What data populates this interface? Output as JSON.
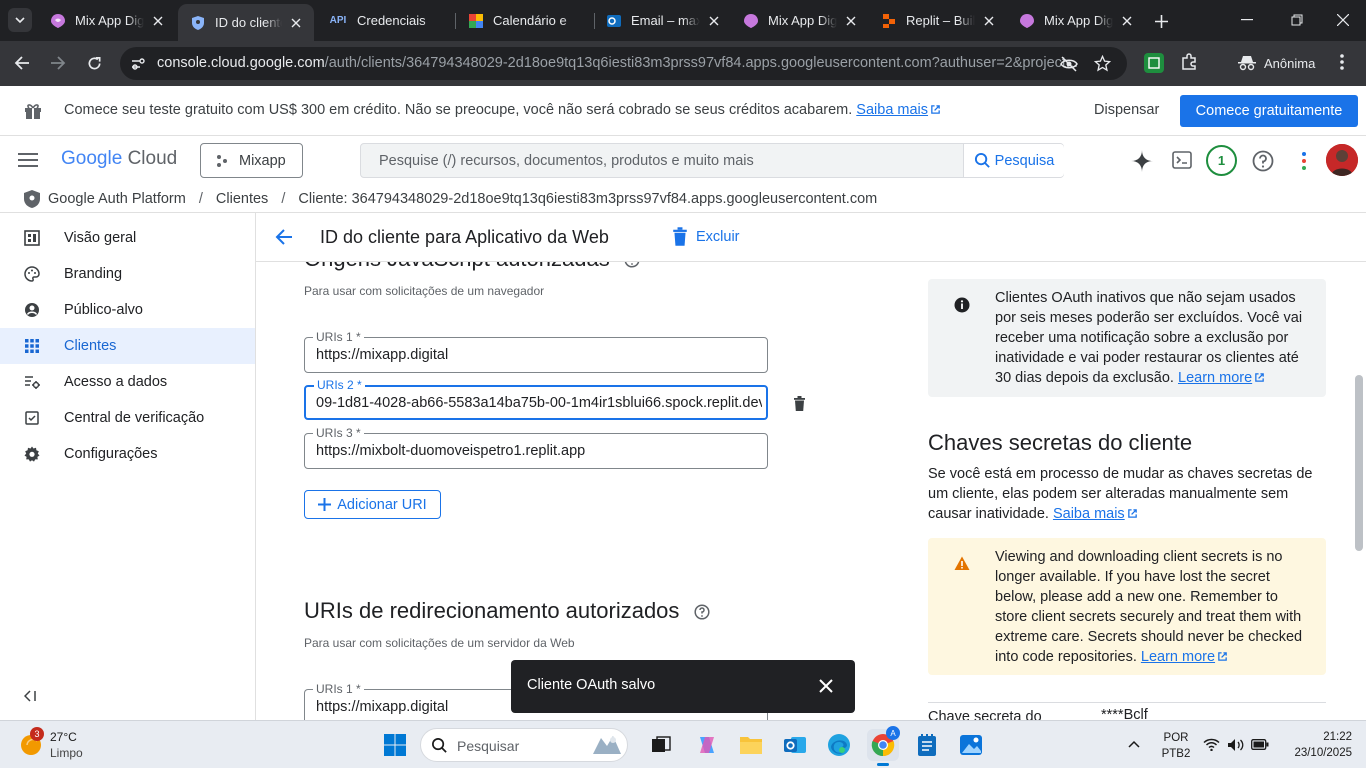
{
  "browser": {
    "tabs": [
      {
        "title": "Mix App Digital",
        "icon": "mixapp-icon"
      },
      {
        "title": "ID do cliente",
        "icon": "shield-icon",
        "active": true
      },
      {
        "title": "Credenciais",
        "icon": "api-icon"
      },
      {
        "title": "Calendário e",
        "icon": "calendar-icon"
      },
      {
        "title": "Email – max",
        "icon": "outlook-icon"
      },
      {
        "title": "Mix App Digital",
        "icon": "mixapp-icon"
      },
      {
        "title": "Replit – Build",
        "icon": "replit-icon"
      },
      {
        "title": "Mix App Digital",
        "icon": "mixapp-icon"
      }
    ],
    "url_main": "console.cloud.google.com",
    "url_rest": "/auth/clients/364794348029-2d18oe9tq13q6iesti83m3prss97vf84.apps.googleusercontent.com?authuser=2&project...",
    "profile_label": "Anônima"
  },
  "banner": {
    "text": "Comece seu teste gratuito com US$ 300 em crédito. Não se preocupe, você não será cobrado se seus créditos acabarem.",
    "link": "Saiba mais",
    "dismiss": "Dispensar",
    "cta": "Comece gratuitamente"
  },
  "header": {
    "logo_google": "Google",
    "logo_cloud": "Cloud",
    "project": "Mixapp",
    "search_placeholder": "Pesquise (/) recursos, documentos, produtos e muito mais",
    "search_button": "Pesquisa",
    "notification_count": "1"
  },
  "breadcrumb": {
    "items": [
      "Google Auth Platform",
      "Clientes",
      "Cliente: 364794348029-2d18oe9tq13q6iesti83m3prss97vf84.apps.googleusercontent.com"
    ],
    "separator": "/"
  },
  "sidebar": {
    "items": [
      {
        "label": "Visão geral",
        "icon": "dashboard-icon"
      },
      {
        "label": "Branding",
        "icon": "palette-icon"
      },
      {
        "label": "Público-alvo",
        "icon": "person-icon"
      },
      {
        "label": "Clientes",
        "icon": "grid-icon",
        "selected": true
      },
      {
        "label": "Acesso a dados",
        "icon": "data-access-icon"
      },
      {
        "label": "Central de verificação",
        "icon": "checkbox-icon"
      },
      {
        "label": "Configurações",
        "icon": "gear-icon"
      }
    ]
  },
  "page": {
    "title": "ID do cliente para Aplicativo da Web",
    "delete_label": "Excluir",
    "origins": {
      "title": "Origens JavaScript autorizadas",
      "hint": "Para usar com solicitações de um navegador",
      "uris": [
        {
          "label": "URIs 1 *",
          "value": "https://mixapp.digital"
        },
        {
          "label": "URIs 2 *",
          "value": "09-1d81-4028-ab66-5583a14ba75b-00-1m4ir1sblui66.spock.replit.dev"
        },
        {
          "label": "URIs 3 *",
          "value": "https://mixbolt-duomoveispetro1.replit.app"
        }
      ],
      "add_label": "Adicionar URI"
    },
    "redirects": {
      "title": "URIs de redirecionamento autorizados",
      "hint": "Para usar com solicitações de um servidor da Web",
      "uris": [
        {
          "label": "URIs 1 *",
          "value": "https://mixapp.digital"
        }
      ]
    }
  },
  "right": {
    "inactive_note": "Clientes OAuth inativos que não sejam usados por seis meses poderão ser excluídos. Você vai receber uma notificação sobre a exclusão por inatividade e vai poder restaurar os clientes até 30 dias depois da exclusão.",
    "learn_more": "Learn more",
    "secrets_title": "Chaves secretas do cliente",
    "secrets_desc": "Se você está em processo de mudar as chaves secretas de um cliente, elas podem ser alteradas manualmente sem causar inatividade.",
    "secrets_link": "Saiba mais",
    "warning": "Viewing and downloading client secrets is no longer available. If you have lost the secret below, please add a new one. Remember to store client secrets securely and treat them with extreme care. Secrets should never be checked into code repositories.",
    "warning_link": "Learn more",
    "secret_row_label": "Chave secreta do",
    "secret_row_value": "****Bclf"
  },
  "snackbar": {
    "text": "Cliente OAuth salvo"
  },
  "taskbar": {
    "weather_temp": "27°C",
    "weather_desc": "Limpo",
    "weather_badge": "3",
    "search_placeholder": "Pesquisar",
    "lang1": "POR",
    "lang2": "PTB2",
    "time": "21:22",
    "date": "23/10/2025"
  },
  "colors": {
    "accent": "#1a73e8",
    "selected_bg": "#e8f0fe",
    "warning": "#f9ab00"
  }
}
